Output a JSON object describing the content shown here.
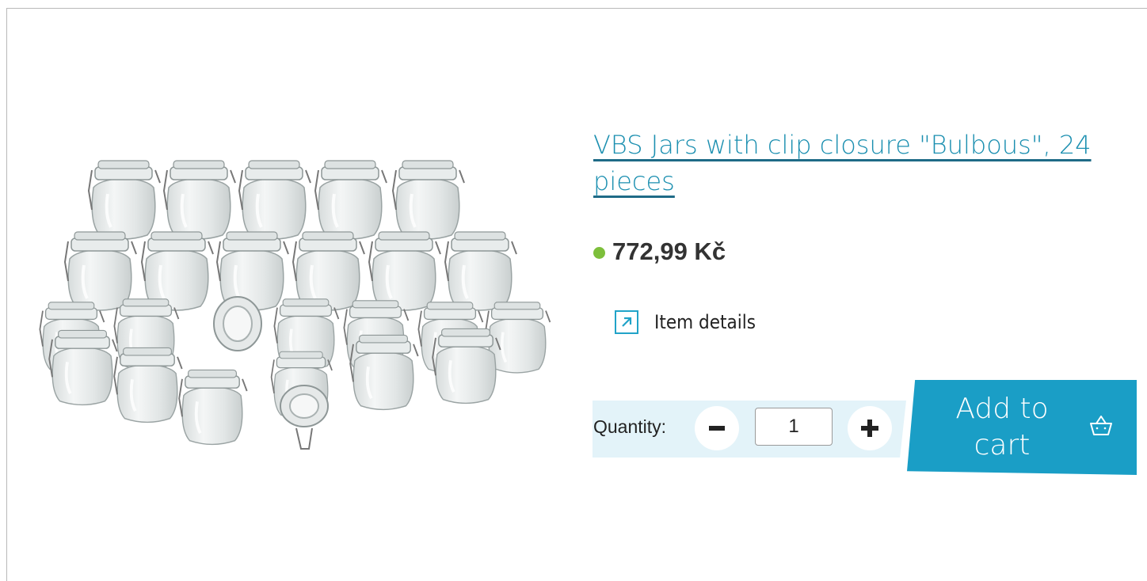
{
  "product": {
    "title": "VBS Jars with clip closure \"Bulbous\", 24 pieces",
    "price": "772,99 Kč",
    "stock_color": "#7dbf3b",
    "details_label": "Item details",
    "details_icon": "external-arrow-icon"
  },
  "cart": {
    "quantity_label": "Quantity:",
    "quantity_value": "1",
    "minus_icon": "minus-icon",
    "plus_icon": "plus-icon",
    "add_label": "Add to cart",
    "basket_icon": "basket-icon",
    "accent_color": "#1a9ec6"
  }
}
